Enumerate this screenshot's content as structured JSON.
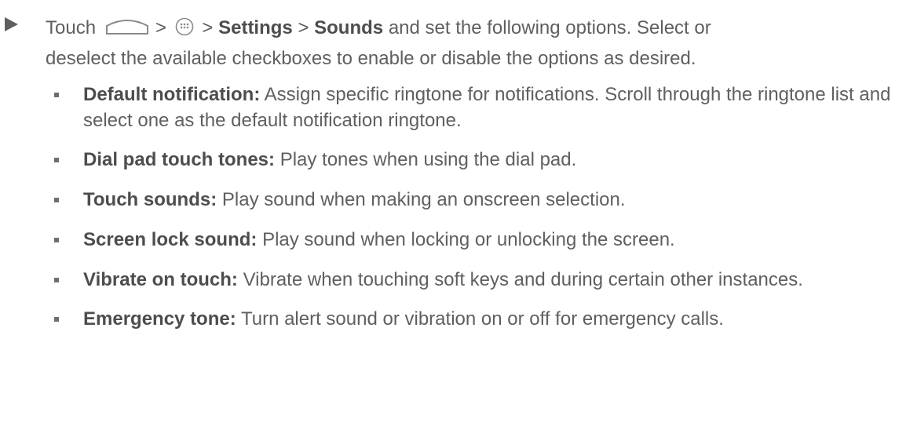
{
  "instruction": {
    "touch_word": "Touch",
    "sep1": ">",
    "sep2": ">",
    "settings": "Settings",
    "sep3": ">",
    "sounds": "Sounds",
    "rest_line1": "and set the following options. Select or",
    "rest_line2": "deselect the available checkboxes to enable or disable the options as desired.",
    "home_icon": "home-icon",
    "apps_icon": "apps-icon"
  },
  "options": [
    {
      "term": "Default notification:",
      "text": "Assign specific ringtone for notifications. Scroll through the ringtone list and select one as the default notification ringtone."
    },
    {
      "term": "Dial pad touch tones:",
      "text": "Play tones when using the dial pad."
    },
    {
      "term": "Touch sounds:",
      "text": "Play sound when making an onscreen selection."
    },
    {
      "term": "Screen lock sound:",
      "text": "Play sound when locking or unlocking the screen."
    },
    {
      "term": "Vibrate on touch:",
      "text": "Vibrate when touching soft keys and during certain other instances."
    },
    {
      "term": "Emergency tone:",
      "text": "Turn alert sound or vibration on or off for emergency calls."
    }
  ]
}
